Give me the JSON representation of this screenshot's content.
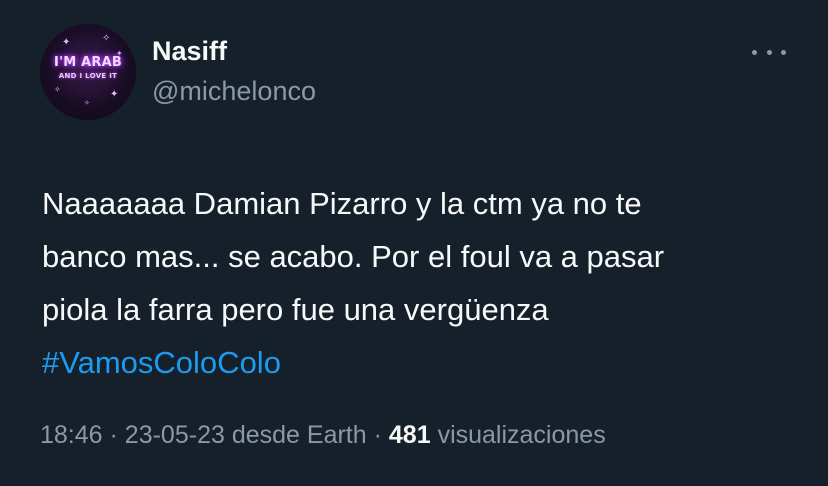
{
  "author": {
    "display_name": "Nasiff",
    "handle": "@michelonco",
    "avatar_text_line1": "I'M ARAB",
    "avatar_text_line2": "AND I LOVE IT"
  },
  "tweet": {
    "lines": [
      "Naaaaaaa Damian Pizarro y la ctm ya no te",
      "banco mas... se acabo. Por el foul va a pasar",
      "piola la farra pero fue una vergüenza"
    ],
    "hashtag": "#VamosColoColo"
  },
  "meta": {
    "time": "18:46",
    "separator1": "·",
    "date": "23-05-23",
    "source": "desde Earth",
    "separator2": "·",
    "views_count": "481",
    "views_label": "visualizaciones"
  },
  "icons": {
    "more": "more-options-icon"
  },
  "colors": {
    "background": "#15202b",
    "text_primary": "#f7f9f9",
    "text_secondary": "#8b98a5",
    "hashtag": "#1d9bf0"
  }
}
